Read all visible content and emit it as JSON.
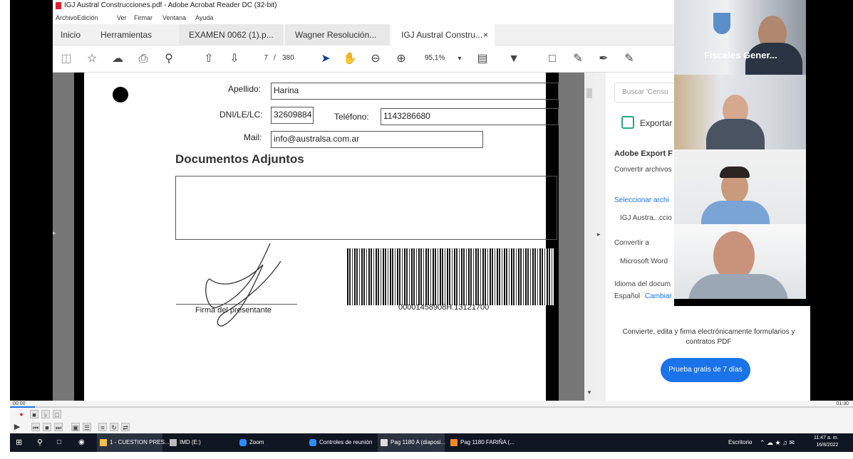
{
  "acrobat": {
    "title": "IGJ Austral Construcciones.pdf - Adobe Acrobat Reader DC (32-bit)",
    "menu": [
      "Archivo",
      "Edición",
      "Ver",
      "Firmar",
      "Ventana",
      "Ayuda"
    ],
    "tabs": {
      "home": "Inicio",
      "tools": "Herramientas",
      "docs": [
        "EXAMEN 0062 (1).p...",
        "Wagner Resolución...",
        "IGJ Austral Constru..."
      ],
      "close": "×"
    },
    "toolbar": {
      "page_current": "7",
      "page_sep": "/",
      "page_total": "380",
      "zoom": "95,1%"
    }
  },
  "document": {
    "apellido_label": "Apellido:",
    "apellido_value": "Harina",
    "dni_label": "DNI/LE/LC:",
    "dni_value": "32609884",
    "telefono_label": "Teléfono:",
    "telefono_value": "1143286680",
    "mail_label": "Mail:",
    "mail_value": "info@australsa.com.ar",
    "section_title": "Documentos Adjuntos",
    "signature_label": "Firma del presentante",
    "barcode_number": "00001458908H.13121700"
  },
  "right_panel": {
    "search_placeholder": "Buscar 'Censu",
    "export_label": "Exportar",
    "export_title": "Adobe Export F",
    "convert_files": "Convertir archivos",
    "select_file": "Seleccionar archi",
    "file_name": "IGJ Austra...ccio",
    "convert_to": "Convertir a",
    "format": "Microsoft Word",
    "language_label": "Idioma del docum",
    "language_value": "Español",
    "change": "Cambiar",
    "promo_text": "Convierte, edita y firma electrónicamente formularios y contratos PDF",
    "promo_button": "Prueba gratis de 7 días"
  },
  "zoom": {
    "participant_name": "Fiscales Gener...",
    "logo": "zoom"
  },
  "player": {
    "time_start": "00:00",
    "time_end": "01:30"
  },
  "taskbar": {
    "items": [
      "1 - CUESTION PRES...",
      "IMD (E:)",
      "Zoom",
      "Controles de reunión",
      "Pag 1180 A (diaposi...",
      "Pag 1180 FARIÑA (..."
    ],
    "desktop": "Escritorio",
    "time": "11:47 a. m.",
    "date": "16/8/2022"
  },
  "colors": {
    "accent": "#1a73e8",
    "pdf_red": "#d9232e",
    "taskbar": "#101622"
  }
}
